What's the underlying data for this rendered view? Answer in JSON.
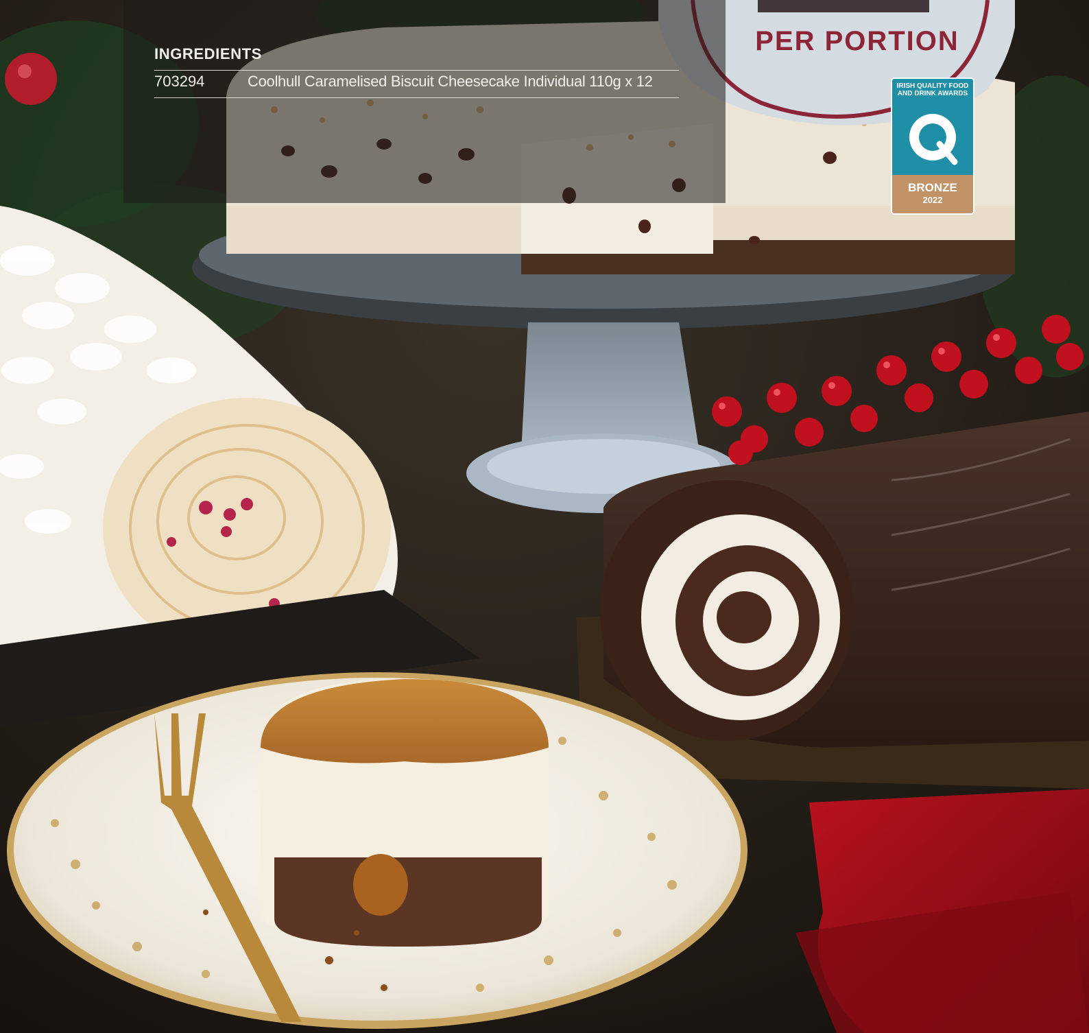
{
  "ingredients": {
    "heading": "INGREDIENTS",
    "items": [
      {
        "code": "703294",
        "description": "Coolhull Caramelised Biscuit Cheesecake Individual 110g x 12"
      }
    ]
  },
  "price_badge": {
    "label": "PER PORTION",
    "color": "#8c2538"
  },
  "award_badge": {
    "title_line1": "IRISH QUALITY FOOD",
    "title_line2": "AND DRINK AWARDS",
    "level": "BRONZE",
    "year": "2022",
    "color": "#1e8fa6"
  },
  "photo": {
    "subject": "photo-desserts"
  }
}
